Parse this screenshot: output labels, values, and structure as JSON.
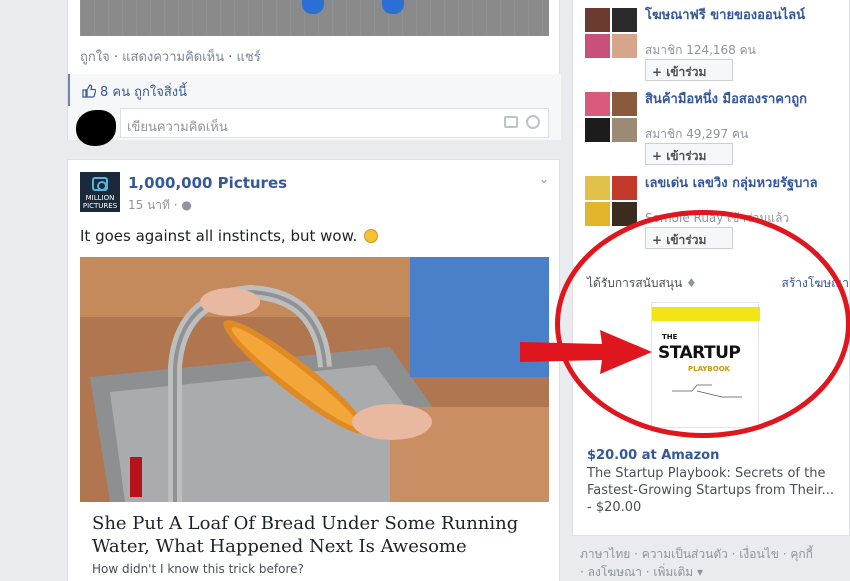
{
  "top_post": {
    "actions": [
      "ถูกใจ",
      "แสดงความคิดเห็น",
      "แชร์"
    ],
    "likes_text": "8 คน ถูกใจสิ่งนี้",
    "comment_placeholder": "เขียนความคิดเห็น"
  },
  "main_post": {
    "page_logo_text": "MILLION PICTURES",
    "page_name": "1,000,000 Pictures",
    "time": "15 นาที",
    "text": "It goes against all instincts, but wow.",
    "link_title": "She Put A Loaf Of Bread Under Some Running Water, What Happened Next Is Awesome",
    "link_description": "How didn't I know this trick before?"
  },
  "groups": [
    {
      "name": "โฆษณาฟรี ขายของออนไลน์",
      "members": "สมาชิก 124,168 คน",
      "join": "+ เข้าร่วม"
    },
    {
      "name": "สินค้ามือหนึ่ง มือสองราคาถูก",
      "members": "สมาชิก 49,297 คน",
      "join": "+ เข้าร่วม"
    },
    {
      "name": "เลขเด่น เลขวิง กลุ่มหวยรัฐบาล",
      "members": "Somole Ruay เข้าร่วมแล้ว",
      "join": "+ เข้าร่วม"
    }
  ],
  "ads": {
    "sponsored_label": "ได้รับการสนับสนุน",
    "create_ad": "สร้างโฆษณา",
    "book_cover": {
      "title_top": "THE",
      "title": "STARTUP",
      "subtitle": "PLAYBOOK"
    },
    "price": "$20.00 at Amazon",
    "description": "The Startup Playbook: Secrets of the Fastest-Growing Startups from Their... - $20.00"
  },
  "footer": {
    "line1": "ภาษาไทย · ความเป็นส่วนตัว · เงื่อนไข · คุกกี้",
    "line2": "· ลงโฆษณา · เพิ่มเติม ▾"
  },
  "colors": {
    "link": "#365899",
    "annotation_red": "#e0161e"
  }
}
